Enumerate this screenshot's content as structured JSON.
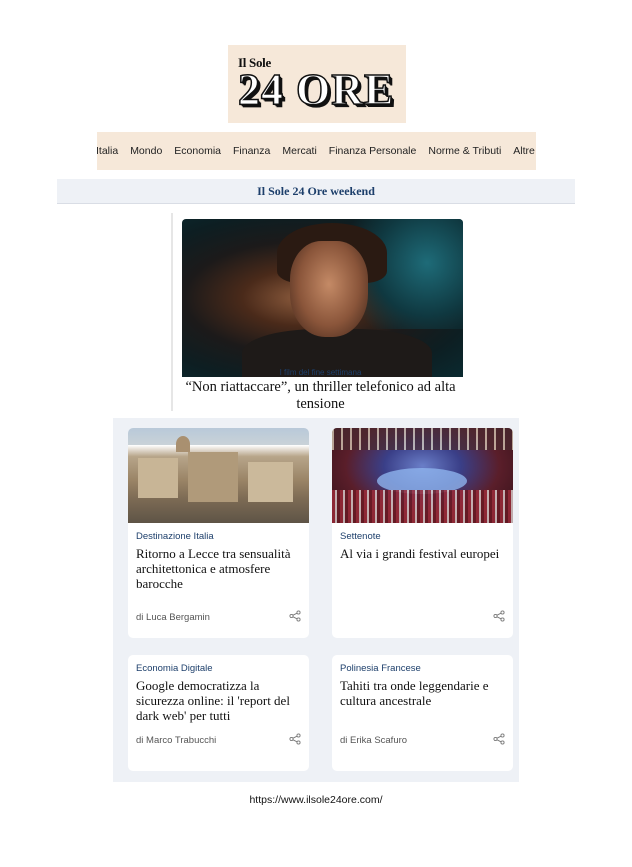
{
  "logo": {
    "line1": "Il Sole",
    "line2": "24 ORE"
  },
  "nav": {
    "items": [
      {
        "label": "Italia"
      },
      {
        "label": "Mondo"
      },
      {
        "label": "Economia"
      },
      {
        "label": "Finanza"
      },
      {
        "label": "Mercati"
      },
      {
        "label": "Finanza Personale"
      },
      {
        "label": "Norme & Tributi"
      },
      {
        "label": "Altre"
      }
    ]
  },
  "weekend": {
    "title": "Il Sole 24 Ore weekend"
  },
  "hero": {
    "kicker": "I film del fine settimana",
    "title": "“Non riattaccare”, un thriller telefonico ad alta tensione"
  },
  "cards": [
    {
      "kicker": "Destinazione Italia",
      "title": "Ritorno a Lecce tra sensualità architettonica e atmosfere barocche",
      "author": "di Luca Bergamin"
    },
    {
      "kicker": "Settenote",
      "title": "Al via i grandi festival europei",
      "author": ""
    },
    {
      "kicker": "Economia Digitale",
      "title": "Google democratizza la sicurezza online: il 'report del dark web' per tutti",
      "author": "di Marco Trabucchi"
    },
    {
      "kicker": "Polinesia Francese",
      "title": "Tahiti tra onde leggendarie e cultura ancestrale",
      "author": "di Erika Scafuro"
    }
  ],
  "footer": {
    "url": "https://www.ilsole24ore.com/"
  },
  "colors": {
    "accent": "#1d3f6b",
    "logo_bg": "#f6e8d9",
    "panel_bg": "#eef1f6"
  }
}
